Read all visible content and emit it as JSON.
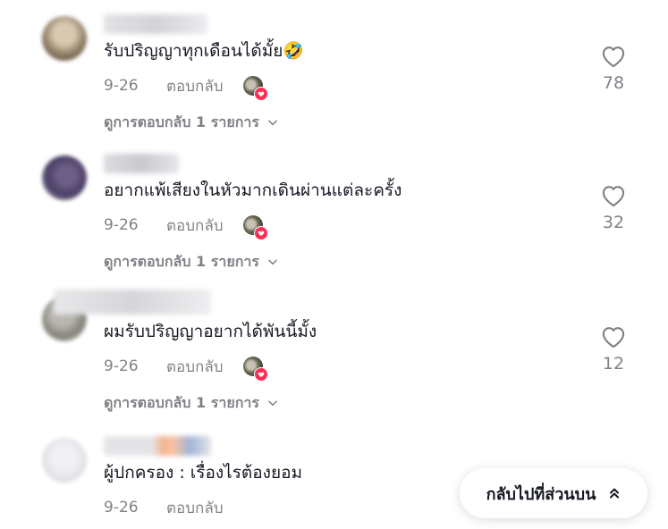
{
  "comments": [
    {
      "text": "รับปริญญาทุกเดือนได้มั้ย🤣",
      "date": "9-26",
      "reply_label": "ตอบกลับ",
      "view_replies": "ดูการตอบกลับ 1 รายการ",
      "likes": "78"
    },
    {
      "text": "อยากแพ้เสียงในหัวมากเดินผ่านแต่ละครั้ง",
      "date": "9-26",
      "reply_label": "ตอบกลับ",
      "view_replies": "ดูการตอบกลับ 1 รายการ",
      "likes": "32"
    },
    {
      "text": "ผมรับปริญญาอยากได้พันนี้มั้ง",
      "date": "9-26",
      "reply_label": "ตอบกลับ",
      "view_replies": "ดูการตอบกลับ 1 รายการ",
      "likes": "12"
    },
    {
      "text": "ผู้ปกครอง : เรื่องไรต้องยอม",
      "date": "9-26",
      "reply_label": "ตอบกลับ"
    }
  ],
  "back_to_top": "กลับไปที่ส่วนบน",
  "colors": {
    "text": "#161823",
    "muted": "rgba(22,24,35,0.55)",
    "accent": "#fe2c55"
  },
  "icons": {
    "like": "heart-outline-icon",
    "expand": "chevron-down-icon",
    "back_to_top": "double-chevron-up-icon",
    "creator_badge": "heart-badge-icon"
  }
}
